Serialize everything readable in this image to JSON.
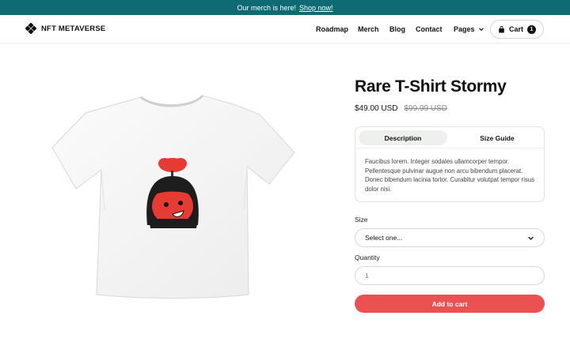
{
  "banner": {
    "text": "Our merch is here!",
    "link": "Shop now!"
  },
  "nav": {
    "logo": "NFT METAVERSE",
    "links": [
      "Roadmap",
      "Merch",
      "Blog",
      "Contact"
    ],
    "pages": "Pages",
    "cart": {
      "label": "Cart",
      "count": "1"
    }
  },
  "product": {
    "title": "Rare T-Shirt Stormy",
    "price": "$49.00 USD",
    "old_price": "$99.99 USD",
    "tabs": [
      "Description",
      "Size Guide"
    ],
    "description": "Faucibus lorem. Integer sodales ullamcorper tempor. Pellentesque pulvinar augue non arcu bibendum placerat. Donec bibendum lacinia tortor. Curabitur volutpat tempor risus dolor nisi.",
    "size_label": "Size",
    "size_value": "Select one...",
    "quantity_label": "Quantity",
    "quantity_value": "1",
    "add_to_cart": "Add to cart"
  },
  "colors": {
    "banner": "#0f6b73",
    "accent": "#ea5150"
  }
}
